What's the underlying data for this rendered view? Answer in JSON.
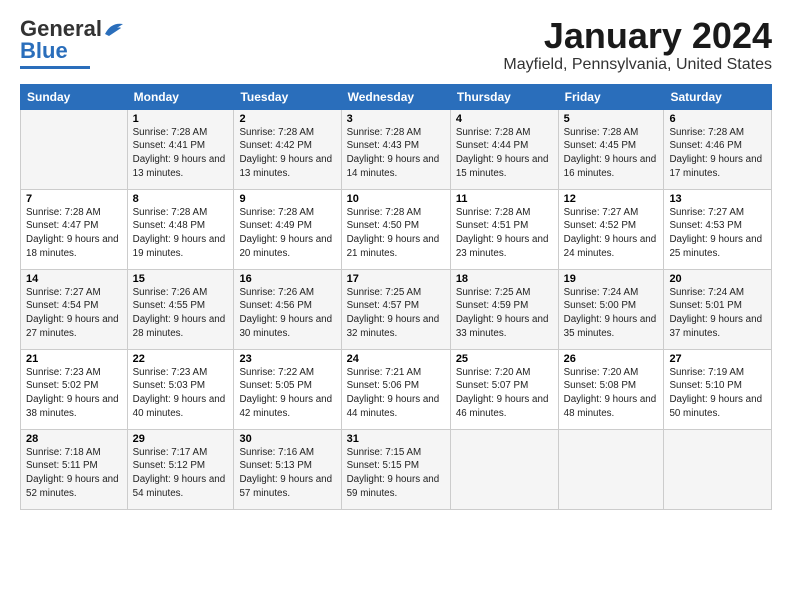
{
  "header": {
    "logo_general": "General",
    "logo_blue": "Blue",
    "title": "January 2024",
    "subtitle": "Mayfield, Pennsylvania, United States"
  },
  "days_of_week": [
    "Sunday",
    "Monday",
    "Tuesday",
    "Wednesday",
    "Thursday",
    "Friday",
    "Saturday"
  ],
  "weeks": [
    [
      {
        "num": "",
        "sunrise": "",
        "sunset": "",
        "daylight": ""
      },
      {
        "num": "1",
        "sunrise": "Sunrise: 7:28 AM",
        "sunset": "Sunset: 4:41 PM",
        "daylight": "Daylight: 9 hours and 13 minutes."
      },
      {
        "num": "2",
        "sunrise": "Sunrise: 7:28 AM",
        "sunset": "Sunset: 4:42 PM",
        "daylight": "Daylight: 9 hours and 13 minutes."
      },
      {
        "num": "3",
        "sunrise": "Sunrise: 7:28 AM",
        "sunset": "Sunset: 4:43 PM",
        "daylight": "Daylight: 9 hours and 14 minutes."
      },
      {
        "num": "4",
        "sunrise": "Sunrise: 7:28 AM",
        "sunset": "Sunset: 4:44 PM",
        "daylight": "Daylight: 9 hours and 15 minutes."
      },
      {
        "num": "5",
        "sunrise": "Sunrise: 7:28 AM",
        "sunset": "Sunset: 4:45 PM",
        "daylight": "Daylight: 9 hours and 16 minutes."
      },
      {
        "num": "6",
        "sunrise": "Sunrise: 7:28 AM",
        "sunset": "Sunset: 4:46 PM",
        "daylight": "Daylight: 9 hours and 17 minutes."
      }
    ],
    [
      {
        "num": "7",
        "sunrise": "Sunrise: 7:28 AM",
        "sunset": "Sunset: 4:47 PM",
        "daylight": "Daylight: 9 hours and 18 minutes."
      },
      {
        "num": "8",
        "sunrise": "Sunrise: 7:28 AM",
        "sunset": "Sunset: 4:48 PM",
        "daylight": "Daylight: 9 hours and 19 minutes."
      },
      {
        "num": "9",
        "sunrise": "Sunrise: 7:28 AM",
        "sunset": "Sunset: 4:49 PM",
        "daylight": "Daylight: 9 hours and 20 minutes."
      },
      {
        "num": "10",
        "sunrise": "Sunrise: 7:28 AM",
        "sunset": "Sunset: 4:50 PM",
        "daylight": "Daylight: 9 hours and 21 minutes."
      },
      {
        "num": "11",
        "sunrise": "Sunrise: 7:28 AM",
        "sunset": "Sunset: 4:51 PM",
        "daylight": "Daylight: 9 hours and 23 minutes."
      },
      {
        "num": "12",
        "sunrise": "Sunrise: 7:27 AM",
        "sunset": "Sunset: 4:52 PM",
        "daylight": "Daylight: 9 hours and 24 minutes."
      },
      {
        "num": "13",
        "sunrise": "Sunrise: 7:27 AM",
        "sunset": "Sunset: 4:53 PM",
        "daylight": "Daylight: 9 hours and 25 minutes."
      }
    ],
    [
      {
        "num": "14",
        "sunrise": "Sunrise: 7:27 AM",
        "sunset": "Sunset: 4:54 PM",
        "daylight": "Daylight: 9 hours and 27 minutes."
      },
      {
        "num": "15",
        "sunrise": "Sunrise: 7:26 AM",
        "sunset": "Sunset: 4:55 PM",
        "daylight": "Daylight: 9 hours and 28 minutes."
      },
      {
        "num": "16",
        "sunrise": "Sunrise: 7:26 AM",
        "sunset": "Sunset: 4:56 PM",
        "daylight": "Daylight: 9 hours and 30 minutes."
      },
      {
        "num": "17",
        "sunrise": "Sunrise: 7:25 AM",
        "sunset": "Sunset: 4:57 PM",
        "daylight": "Daylight: 9 hours and 32 minutes."
      },
      {
        "num": "18",
        "sunrise": "Sunrise: 7:25 AM",
        "sunset": "Sunset: 4:59 PM",
        "daylight": "Daylight: 9 hours and 33 minutes."
      },
      {
        "num": "19",
        "sunrise": "Sunrise: 7:24 AM",
        "sunset": "Sunset: 5:00 PM",
        "daylight": "Daylight: 9 hours and 35 minutes."
      },
      {
        "num": "20",
        "sunrise": "Sunrise: 7:24 AM",
        "sunset": "Sunset: 5:01 PM",
        "daylight": "Daylight: 9 hours and 37 minutes."
      }
    ],
    [
      {
        "num": "21",
        "sunrise": "Sunrise: 7:23 AM",
        "sunset": "Sunset: 5:02 PM",
        "daylight": "Daylight: 9 hours and 38 minutes."
      },
      {
        "num": "22",
        "sunrise": "Sunrise: 7:23 AM",
        "sunset": "Sunset: 5:03 PM",
        "daylight": "Daylight: 9 hours and 40 minutes."
      },
      {
        "num": "23",
        "sunrise": "Sunrise: 7:22 AM",
        "sunset": "Sunset: 5:05 PM",
        "daylight": "Daylight: 9 hours and 42 minutes."
      },
      {
        "num": "24",
        "sunrise": "Sunrise: 7:21 AM",
        "sunset": "Sunset: 5:06 PM",
        "daylight": "Daylight: 9 hours and 44 minutes."
      },
      {
        "num": "25",
        "sunrise": "Sunrise: 7:20 AM",
        "sunset": "Sunset: 5:07 PM",
        "daylight": "Daylight: 9 hours and 46 minutes."
      },
      {
        "num": "26",
        "sunrise": "Sunrise: 7:20 AM",
        "sunset": "Sunset: 5:08 PM",
        "daylight": "Daylight: 9 hours and 48 minutes."
      },
      {
        "num": "27",
        "sunrise": "Sunrise: 7:19 AM",
        "sunset": "Sunset: 5:10 PM",
        "daylight": "Daylight: 9 hours and 50 minutes."
      }
    ],
    [
      {
        "num": "28",
        "sunrise": "Sunrise: 7:18 AM",
        "sunset": "Sunset: 5:11 PM",
        "daylight": "Daylight: 9 hours and 52 minutes."
      },
      {
        "num": "29",
        "sunrise": "Sunrise: 7:17 AM",
        "sunset": "Sunset: 5:12 PM",
        "daylight": "Daylight: 9 hours and 54 minutes."
      },
      {
        "num": "30",
        "sunrise": "Sunrise: 7:16 AM",
        "sunset": "Sunset: 5:13 PM",
        "daylight": "Daylight: 9 hours and 57 minutes."
      },
      {
        "num": "31",
        "sunrise": "Sunrise: 7:15 AM",
        "sunset": "Sunset: 5:15 PM",
        "daylight": "Daylight: 9 hours and 59 minutes."
      },
      {
        "num": "",
        "sunrise": "",
        "sunset": "",
        "daylight": ""
      },
      {
        "num": "",
        "sunrise": "",
        "sunset": "",
        "daylight": ""
      },
      {
        "num": "",
        "sunrise": "",
        "sunset": "",
        "daylight": ""
      }
    ]
  ]
}
